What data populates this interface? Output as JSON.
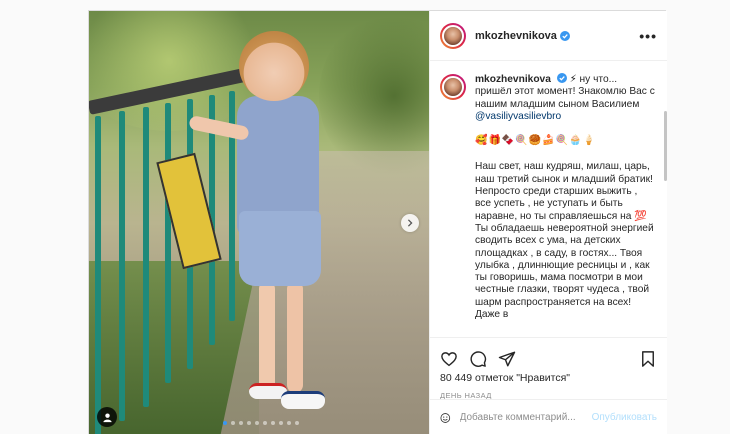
{
  "post": {
    "username": "mkozhevnikova",
    "more_label": "•••"
  },
  "caption": {
    "username": "mkozhevnikova",
    "intro": "⚡ ну что... пришёл этот момент! Знакомлю Вас с нашим младшим сыном Василием",
    "mention": "@vasiliyvasilievbro",
    "emojis": "🥰🎁🍫🍭🥮🍰🍭🧁🍦",
    "paragraph": "Наш свет, наш кудряш, милаш, царь, наш третий сынок и младший братик! Непросто среди старших выжить , все успеть , не уступать и быть наравне, но ты справляешься на 💯 Ты обладаешь невероятной энергией сводить всех с ума, на детских площадках , в саду, в гостях... Твоя улыбка , длиннющие ресницы и , как ты говоришь, мама посмотри в мои честные глазки, творят чудеса , твой шарм распространяется на всех! Даже в"
  },
  "actions": {
    "icons": [
      "heart-icon",
      "comment-icon",
      "share-icon",
      "bookmark-icon"
    ],
    "likes_text": "80 449 отметок \"Нравится\"",
    "time_text": "ДЕНЬ НАЗАД"
  },
  "comment": {
    "placeholder": "Добавьте комментарий...",
    "publish_label": "Опубликовать"
  },
  "colors": {
    "accent": "#3897f0",
    "publish_disabled": "#b2dffc",
    "mention": "#00376b"
  },
  "carousel": {
    "slide_count": 10,
    "active_index": 0
  }
}
